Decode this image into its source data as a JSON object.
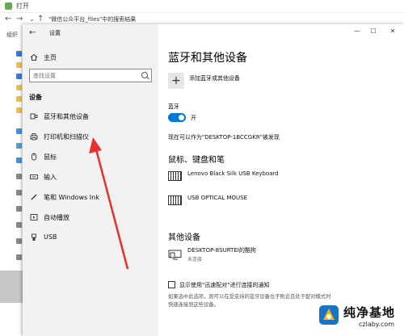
{
  "background_dialog": {
    "title": "打开",
    "breadcrumb": "\"微信公众平台_files\"中的搜索结果",
    "organize_label": "组织"
  },
  "window": {
    "title": "设置",
    "back_glyph": "←",
    "controls": {
      "minimize": "—",
      "maximize": "☐",
      "close": "✕"
    }
  },
  "sidebar": {
    "home_label": "主页",
    "search_placeholder": "查找设置",
    "section_heading": "设备",
    "items": [
      {
        "label": "蓝牙和其他设备",
        "icon": "bluetooth-icon"
      },
      {
        "label": "打印机和扫描仪",
        "icon": "printer-icon"
      },
      {
        "label": "鼠标",
        "icon": "mouse-icon"
      },
      {
        "label": "输入",
        "icon": "keyboard-icon"
      },
      {
        "label": "笔和 Windows Ink",
        "icon": "pen-icon"
      },
      {
        "label": "自动播放",
        "icon": "autoplay-icon"
      },
      {
        "label": "USB",
        "icon": "usb-icon"
      }
    ]
  },
  "main": {
    "title": "蓝牙和其他设备",
    "add_device_label": "添加蓝牙或其他设备",
    "bluetooth": {
      "label": "蓝牙",
      "state_label": "开",
      "on": true,
      "discoverable_text": "现在可以作为\"DESKTOP-1BCCGKR\"被发现"
    },
    "mouse_keyboard_pen": {
      "heading": "鼠标、键盘和笔",
      "devices": [
        {
          "name": "Lenovo Black Silk USB Keyboard",
          "icon": "keyboard-icon"
        },
        {
          "name": "USB OPTICAL MOUSE",
          "icon": "keyboard-icon"
        }
      ]
    },
    "other_devices": {
      "heading": "其他设备",
      "devices": [
        {
          "name": "DESKTOP-8SURTEI的酷狗",
          "status": "未连接",
          "icon": "display-icon"
        }
      ]
    },
    "swift_pair": {
      "label": "显示使用\"迅速配对\"进行连接的通知",
      "checked": false,
      "description": "如果选中此选项，则可以在受支持的蓝牙设备位于附近且处于配对模式时快速连接到这些设备。"
    }
  },
  "watermark": {
    "title": "纯净基地",
    "url": "czlaby.com"
  },
  "colors": {
    "accent": "#0078d7",
    "annotation_arrow": "#e8312b",
    "sidebar_bg": "#f2f2f2"
  }
}
